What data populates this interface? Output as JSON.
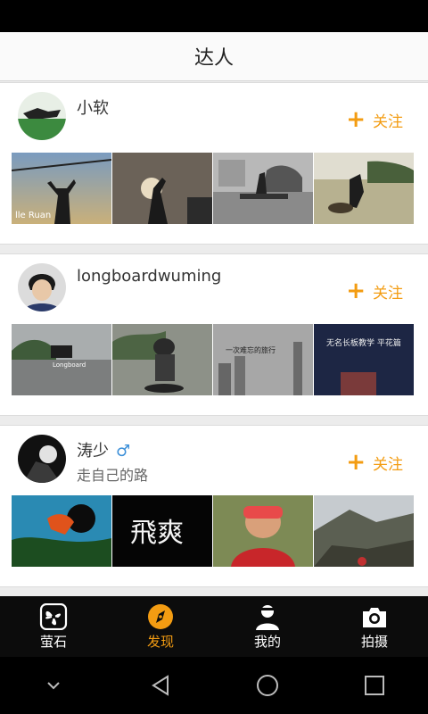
{
  "header": {
    "title": "达人"
  },
  "users": [
    {
      "name": "小软",
      "bio": "",
      "gender_symbol": "",
      "follow_label": "关注",
      "photos": [
        {
          "caption": "lle Ruan"
        },
        {
          "caption": ""
        },
        {
          "caption": ""
        },
        {
          "caption": ""
        }
      ]
    },
    {
      "name": "longboardwuming",
      "bio": "",
      "gender_symbol": "",
      "follow_label": "关注",
      "photos": [
        {
          "caption": "Longboard"
        },
        {
          "caption": ""
        },
        {
          "caption": "一次难忘的旅行"
        },
        {
          "caption": "无名长板教学 平花篇"
        }
      ]
    },
    {
      "name": "涛少",
      "bio": "走自己的路",
      "gender_symbol": "♂",
      "follow_label": "关注",
      "photos": [
        {
          "caption": ""
        },
        {
          "caption": "飛爽"
        },
        {
          "caption": ""
        },
        {
          "caption": ""
        }
      ]
    }
  ],
  "tabs": [
    {
      "label": "萤石",
      "icon": "fan-icon"
    },
    {
      "label": "发现",
      "icon": "compass-icon"
    },
    {
      "label": "我的",
      "icon": "user-icon"
    },
    {
      "label": "拍摄",
      "icon": "camera-icon"
    }
  ],
  "colors": {
    "accent": "#f39c12",
    "gender": "#3b8fd8",
    "tabbar": "#0c0c0c"
  }
}
